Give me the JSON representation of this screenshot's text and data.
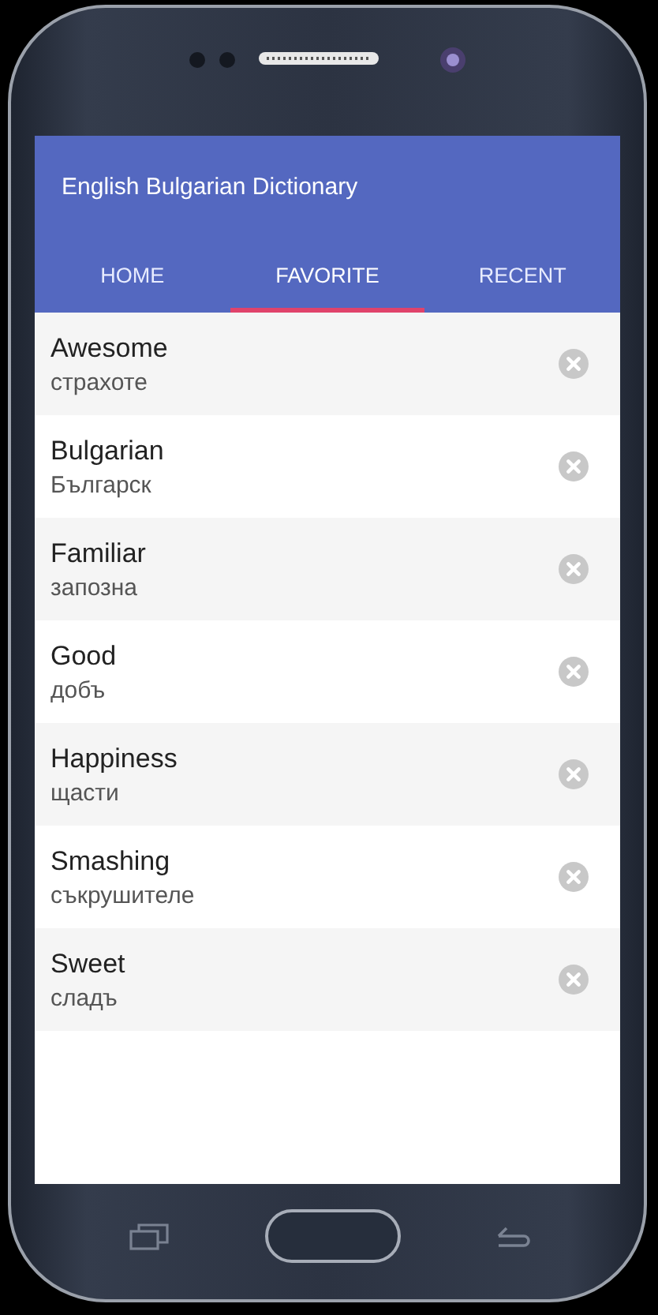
{
  "app_bar": {
    "title": "English Bulgarian Dictionary"
  },
  "tabs": [
    {
      "label": "HOME",
      "selected": false
    },
    {
      "label": "FAVORITE",
      "selected": true
    },
    {
      "label": "RECENT",
      "selected": false
    }
  ],
  "favorites": [
    {
      "word": "Awesome",
      "translation": "страхоте"
    },
    {
      "word": "Bulgarian",
      "translation": "Българск"
    },
    {
      "word": "Familiar",
      "translation": "запозна"
    },
    {
      "word": "Good",
      "translation": "добъ"
    },
    {
      "word": "Happiness",
      "translation": "щасти"
    },
    {
      "word": "Smashing",
      "translation": "съкрушителе"
    },
    {
      "word": "Sweet",
      "translation": "сладъ"
    }
  ]
}
